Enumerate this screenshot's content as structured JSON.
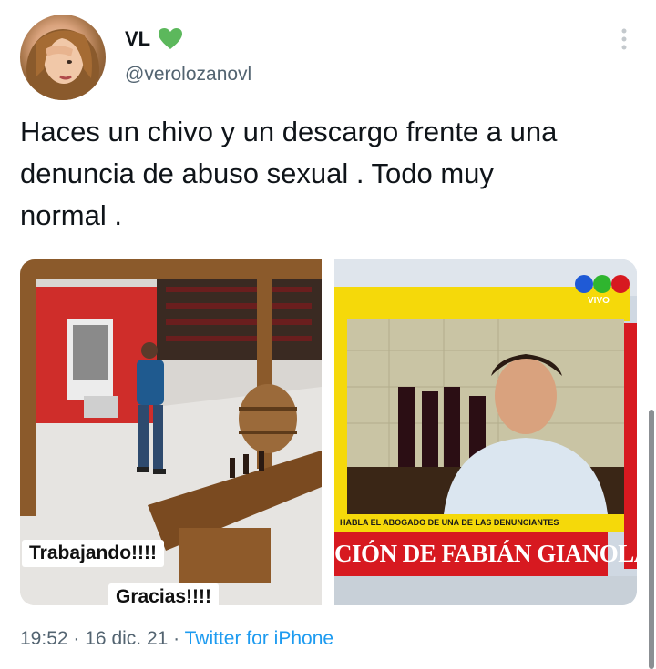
{
  "user": {
    "display_name": "VL",
    "verified_badge_icon": "green-heart-icon",
    "handle": "@verolozanovl"
  },
  "tweet": {
    "text": "Haces un chivo y un descargo frente a una\ndenuncia de abuso sexual . Todo muy\nnormal ."
  },
  "media": {
    "left_photo": {
      "caption_1": "Trabajando!!!!",
      "caption_2": "Gracias!!!!"
    },
    "right_photo": {
      "channel_label": "VIVO",
      "ticker_small": "HABLA EL ABOGADO DE UNA DE LAS DENUNCIANTES",
      "ticker_big": "CIÓN DE FABIÁN GIANOLA"
    }
  },
  "meta": {
    "time": "19:52",
    "date": "16 dic. 21",
    "separator": "·",
    "source": "Twitter for iPhone"
  },
  "colors": {
    "text": "#0f1419",
    "secondary": "#536471",
    "link": "#1d9bf0",
    "heart": "#5cb85c",
    "ticker_red": "#d71920",
    "ticker_yellow": "#f5d90a"
  }
}
